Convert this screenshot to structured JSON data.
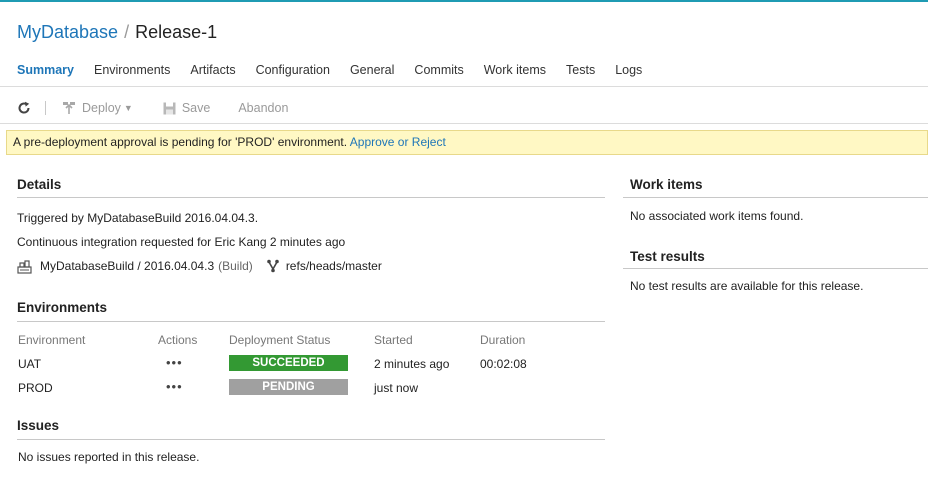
{
  "colors": {
    "accent": "#1e76b8",
    "banner_bg": "#fff8c4",
    "succeeded": "#339933",
    "pending": "#a0a0a0"
  },
  "breadcrumb": {
    "project": "MyDatabase",
    "separator": "/",
    "release": "Release-1"
  },
  "tabs": [
    {
      "label": "Summary",
      "active": true
    },
    {
      "label": "Environments"
    },
    {
      "label": "Artifacts"
    },
    {
      "label": "Configuration"
    },
    {
      "label": "General"
    },
    {
      "label": "Commits"
    },
    {
      "label": "Work items"
    },
    {
      "label": "Tests"
    },
    {
      "label": "Logs"
    }
  ],
  "toolbar": {
    "refresh_icon": "refresh-icon",
    "deploy_label": "Deploy",
    "save_label": "Save",
    "abandon_label": "Abandon"
  },
  "banner": {
    "text": "A pre-deployment approval is pending for 'PROD' environment. ",
    "link": "Approve or Reject"
  },
  "details": {
    "title": "Details",
    "triggered": "Triggered by MyDatabaseBuild 2016.04.04.3.",
    "ci_request": "Continuous integration requested for Eric Kang 2 minutes ago",
    "artifact": "MyDatabaseBuild / 2016.04.04.3",
    "artifact_type": "(Build)",
    "branch": "refs/heads/master"
  },
  "environments": {
    "title": "Environments",
    "headers": {
      "environment": "Environment",
      "actions": "Actions",
      "status": "Deployment Status",
      "started": "Started",
      "duration": "Duration"
    },
    "rows": [
      {
        "name": "UAT",
        "actions": "•••",
        "status": "SUCCEEDED",
        "started": "2 minutes ago",
        "duration": "00:02:08"
      },
      {
        "name": "PROD",
        "actions": "•••",
        "status": "PENDING",
        "started": "just now",
        "duration": ""
      }
    ]
  },
  "issues": {
    "title": "Issues",
    "text": "No issues reported in this release."
  },
  "work_items": {
    "title": "Work items",
    "text": "No associated work items found."
  },
  "test_results": {
    "title": "Test results",
    "text": "No test results are available for this release."
  }
}
